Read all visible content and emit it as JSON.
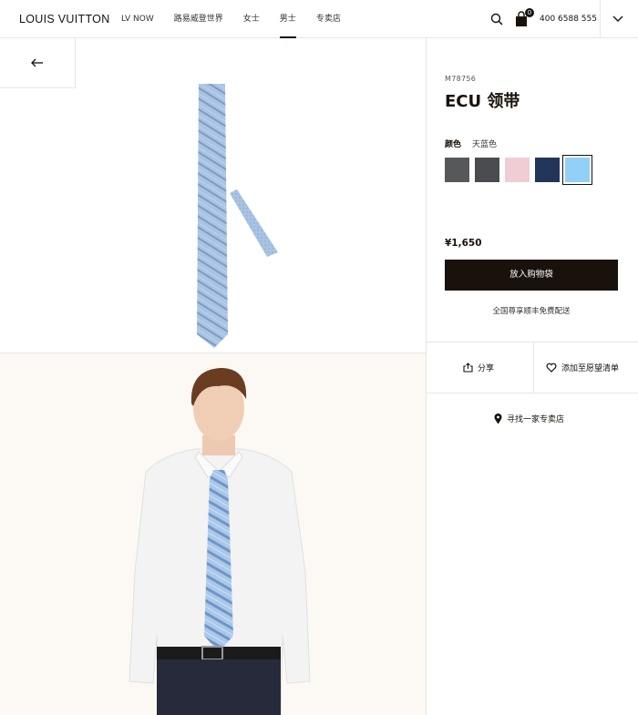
{
  "header": {
    "logo": "LOUIS VUITTON",
    "nav": [
      "LV NOW",
      "路易威登世界",
      "女士",
      "男士",
      "专卖店"
    ],
    "active_nav": "男士",
    "bag_count": "0",
    "phone": "400 6588 555"
  },
  "product": {
    "sku": "M78756",
    "title": "ECU 领带",
    "color_label": "颜色",
    "color_value": "天蓝色",
    "swatches": [
      "#57585a",
      "#4b4c50",
      "#f0cdd5",
      "#22345a",
      "#92d0f8"
    ],
    "selected_swatch": 4,
    "price": "¥1,650",
    "add_to_bag": "放入购物袋",
    "shipping": "全国尊享顺丰免费配送"
  },
  "actions": {
    "share": "分享",
    "wishlist": "添加至愿望清单",
    "find_store": "寻找一家专卖店"
  },
  "colors": {
    "tie_blue": "#a9c3e3",
    "tie_stripe": "#7e9ac4",
    "dark": "#19110b"
  }
}
